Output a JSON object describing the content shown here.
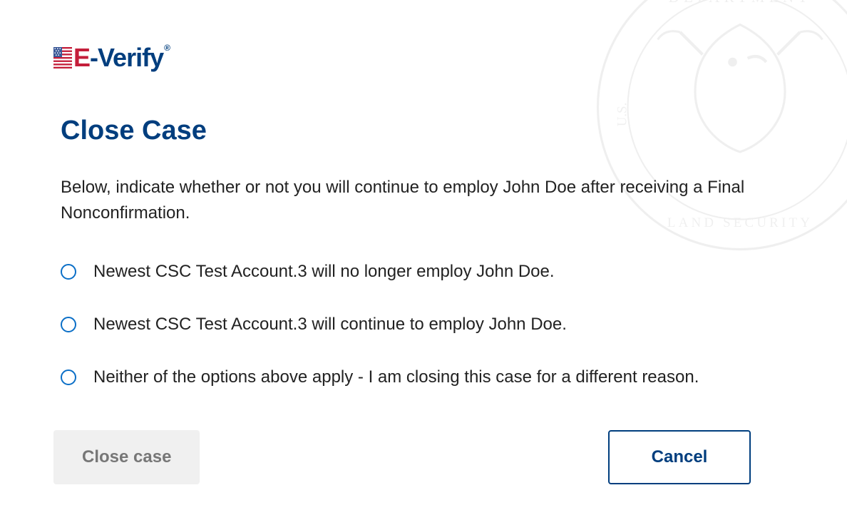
{
  "logo": {
    "e": "E",
    "dash": "-",
    "verify": "Verify",
    "reg": "®"
  },
  "title": "Close Case",
  "instruction": "Below, indicate whether or not you will continue to employ John Doe after receiving a Final Nonconfirmation.",
  "options": [
    "Newest CSC Test Account.3 will no longer employ John Doe.",
    "Newest CSC Test Account.3 will continue to employ John Doe.",
    "Neither of the options above apply - I am closing this case for a different reason."
  ],
  "buttons": {
    "close": "Close case",
    "cancel": "Cancel"
  }
}
